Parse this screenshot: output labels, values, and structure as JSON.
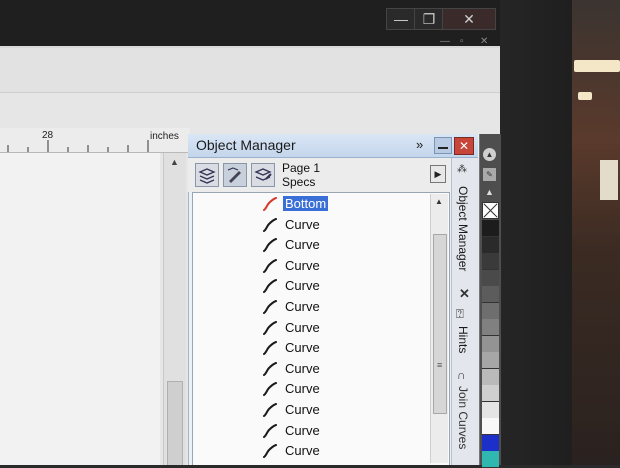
{
  "window": {
    "min_glyph": "—",
    "max_glyph": "❐",
    "close_glyph": "✕",
    "doc_min_glyph": "—",
    "doc_max_glyph": "▫",
    "doc_close_glyph": "✕"
  },
  "ruler": {
    "value": "28",
    "unit": "inches"
  },
  "docker": {
    "title": "Object Manager",
    "expand_glyph": "»",
    "close_glyph": "✕",
    "page_label": "Page 1",
    "layer_label": "Specs",
    "menu_glyph": "▶",
    "items": [
      {
        "label": "Bottom",
        "selected": true,
        "icon_color": "#d23a2a"
      },
      {
        "label": "Curve",
        "selected": false,
        "icon_color": "#1a1a1a"
      },
      {
        "label": "Curve",
        "selected": false,
        "icon_color": "#1a1a1a"
      },
      {
        "label": "Curve",
        "selected": false,
        "icon_color": "#1a1a1a"
      },
      {
        "label": "Curve",
        "selected": false,
        "icon_color": "#1a1a1a"
      },
      {
        "label": "Curve",
        "selected": false,
        "icon_color": "#1a1a1a"
      },
      {
        "label": "Curve",
        "selected": false,
        "icon_color": "#1a1a1a"
      },
      {
        "label": "Curve",
        "selected": false,
        "icon_color": "#1a1a1a"
      },
      {
        "label": "Curve",
        "selected": false,
        "icon_color": "#1a1a1a"
      },
      {
        "label": "Curve",
        "selected": false,
        "icon_color": "#1a1a1a"
      },
      {
        "label": "Curve",
        "selected": false,
        "icon_color": "#1a1a1a"
      },
      {
        "label": "Curve",
        "selected": false,
        "icon_color": "#1a1a1a"
      },
      {
        "label": "Curve",
        "selected": false,
        "icon_color": "#1a1a1a"
      }
    ]
  },
  "vtabs": {
    "object_manager": "Object Manager",
    "hints": "Hints",
    "join_curves": "Join Curves",
    "close_glyph": "✕"
  },
  "palette": {
    "colors": [
      "#1c1c1c",
      "#2a2a2a",
      "#3a3a3a",
      "#4a4a4a",
      "#5c5c5c",
      "#6e6e6e",
      "#808080",
      "#939393",
      "#a6a6a6",
      "#bababa",
      "#cfcfcf",
      "#e4e4e4",
      "#f8f8f8",
      "#1c2fc8",
      "#2fb7b0"
    ]
  },
  "colors": {
    "accent_selection": "#3b6fd8",
    "docker_header": "#c4d6ec"
  }
}
